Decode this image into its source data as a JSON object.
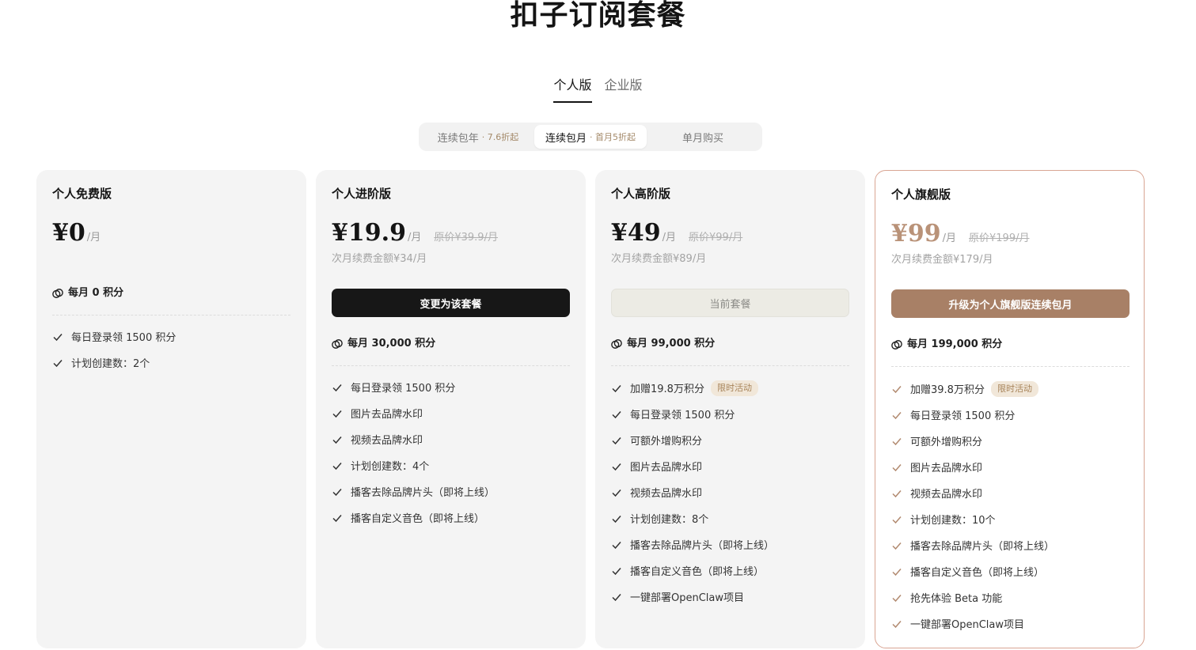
{
  "page_title": "扣子订阅套餐",
  "edition_tabs": [
    {
      "label": "个人版",
      "active": true
    },
    {
      "label": "企业版",
      "active": false
    }
  ],
  "billing_options": [
    {
      "label": "连续包年",
      "promo": "· 7.6折起",
      "active": false
    },
    {
      "label": "连续包月",
      "promo": "· 首月5折起",
      "active": true
    },
    {
      "label": "单月购买",
      "promo": "",
      "active": false
    }
  ],
  "colors": {
    "accent_brown": "#a88066",
    "flagship_border": "#d9a593",
    "card_bg": "#f4f4f4"
  },
  "plans": [
    {
      "name": "个人免费版",
      "price": "¥0",
      "unit": "/月",
      "original_price": "",
      "renewal": "",
      "cta": "",
      "credits": "每月 0 积分",
      "features": [
        "每日登录领 1500 积分",
        "计划创建数：2个"
      ]
    },
    {
      "name": "个人进阶版",
      "price": "¥19.9",
      "unit": "/月",
      "original_price": "原价¥39.9/月",
      "renewal": "次月续费金额¥34/月",
      "cta": "变更为该套餐",
      "credits": "每月 30,000 积分",
      "features": [
        "每日登录领 1500 积分",
        "图片去品牌水印",
        "视频去品牌水印",
        "计划创建数：4个",
        "播客去除品牌片头（即将上线）",
        "播客自定义音色（即将上线）"
      ]
    },
    {
      "name": "个人高阶版",
      "price": "¥49",
      "unit": "/月",
      "original_price": "原价¥99/月",
      "renewal": "次月续费金额¥89/月",
      "cta": "当前套餐",
      "credits": "每月 99,000 积分",
      "badge": "限时活动",
      "features": [
        "加赠19.8万积分",
        "每日登录领 1500 积分",
        "可额外增购积分",
        "图片去品牌水印",
        "视频去品牌水印",
        "计划创建数：8个",
        "播客去除品牌片头（即将上线）",
        "播客自定义音色（即将上线）",
        "一键部署OpenClaw项目"
      ]
    },
    {
      "name": "个人旗舰版",
      "price": "¥99",
      "unit": "/月",
      "original_price": "原价¥199/月",
      "renewal": "次月续费金额¥179/月",
      "cta": "升级为个人旗舰版连续包月",
      "credits": "每月 199,000 积分",
      "badge": "限时活动",
      "features": [
        "加赠39.8万积分",
        "每日登录领 1500 积分",
        "可额外增购积分",
        "图片去品牌水印",
        "视频去品牌水印",
        "计划创建数：10个",
        "播客去除品牌片头（即将上线）",
        "播客自定义音色（即将上线）",
        "抢先体验 Beta 功能",
        "一键部署OpenClaw项目"
      ]
    }
  ]
}
